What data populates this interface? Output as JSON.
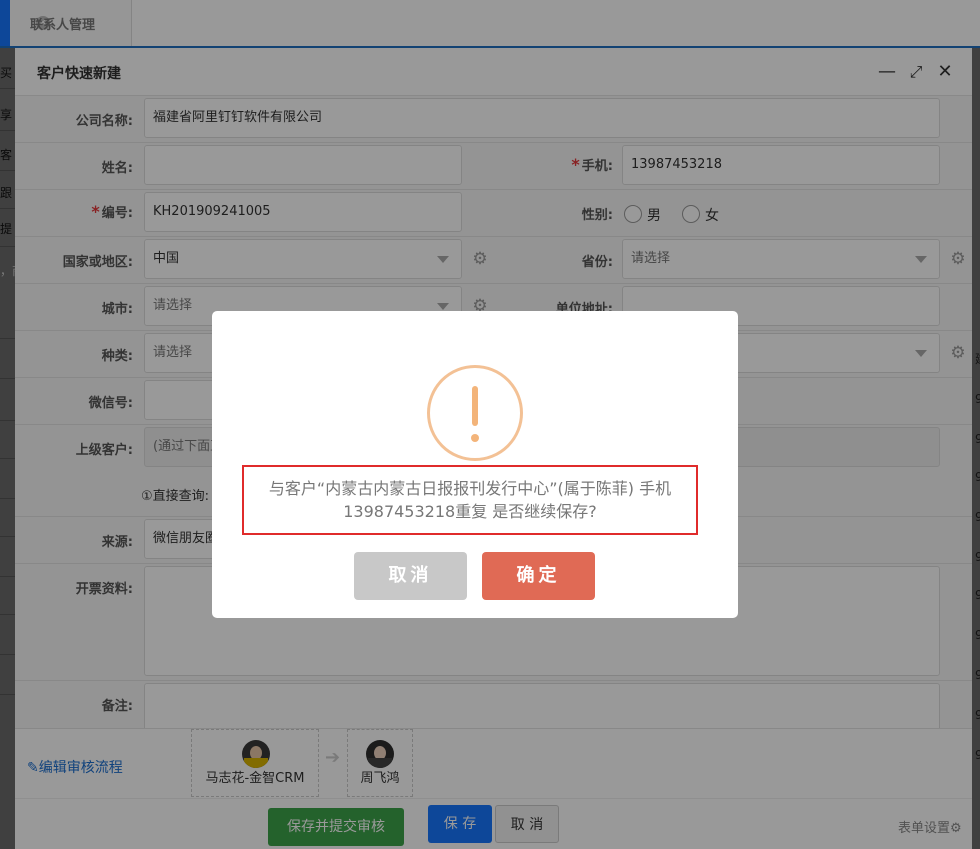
{
  "tabbar": {
    "tab_label": "联系人管理",
    "close_glyph": "×"
  },
  "left_strip": [
    "买",
    "享",
    "客",
    "跟",
    "提",
    "，商"
  ],
  "right_strip": [
    "建",
    "9",
    "9",
    "9",
    "9",
    "9",
    "9",
    "9",
    "9",
    "9",
    "9"
  ],
  "modal": {
    "title": "客户快速新建",
    "controls": {
      "minimize": "—",
      "maximize": "⤢",
      "close": "✕"
    },
    "fields": {
      "company_label": "公司名称:",
      "company_value": "福建省阿里钉钉软件有限公司",
      "name_label": "姓名:",
      "name_value": "",
      "phone_label": "手机:",
      "phone_value": "13987453218",
      "code_label": "编号:",
      "code_value": "KH201909241005",
      "gender_label": "性别:",
      "gender_male": "男",
      "gender_female": "女",
      "country_label": "国家或地区:",
      "country_value": "中国",
      "province_label": "省份:",
      "province_value": "请选择",
      "city_label": "城市:",
      "city_value": "请选择",
      "address_label": "单位地址:",
      "address_value": "",
      "type_label": "种类:",
      "type_value": "请选择",
      "wechat_label": "微信号:",
      "wechat_value": "",
      "parent_label": "上级客户:",
      "parent_value": "(通过下面直",
      "direct_query": "①直接查询:",
      "source_label": "来源:",
      "source_value": "微信朋友圈",
      "invoice_label": "开票资料:",
      "remark_label": "备注:"
    },
    "required_mark": "*",
    "workflow": {
      "edit_link": "编辑审核流程",
      "arrow": "➔",
      "node1": "马志花-金智CRM",
      "node2": "周飞鸿"
    },
    "buttons": {
      "save_submit": "保存并提交审核",
      "save": "保 存",
      "cancel": "取 消",
      "form_settings": "表单设置"
    }
  },
  "dialog": {
    "message_line1": "与客户“内蒙古内蒙古日报报刊发行中心”(属于陈菲) 手机",
    "message_line2": "13987453218重复 是否继续保存?",
    "cancel": "取消",
    "confirm": "确定"
  },
  "colors": {
    "primary_blue": "#1677ff",
    "green": "#3da34a",
    "confirm_red": "#e06a55",
    "cancel_gray": "#c8c8c8",
    "warn_orange": "#f3c195",
    "required_red": "#e4393c"
  }
}
